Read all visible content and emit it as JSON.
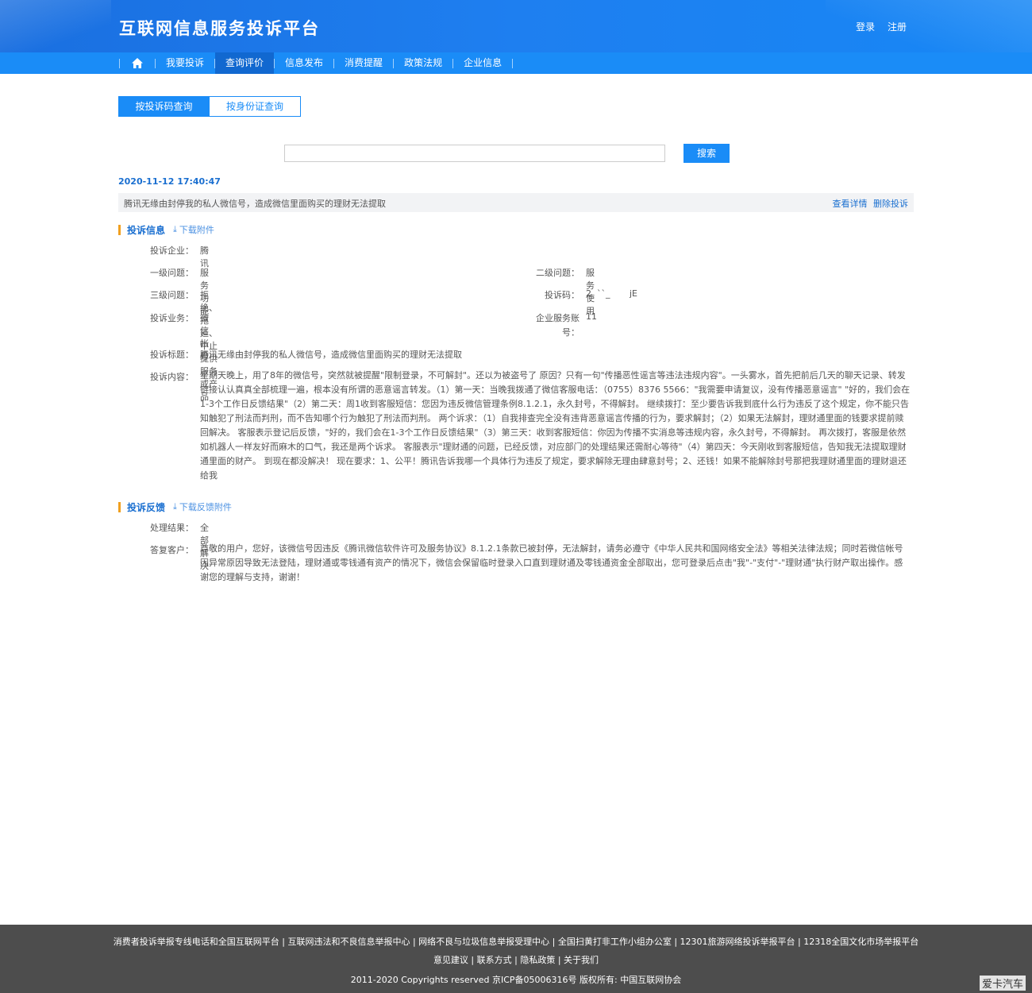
{
  "header": {
    "site_title": "互联网信息服务投诉平台",
    "login": "登录",
    "register": "注册"
  },
  "nav": {
    "home_icon": "home-icon",
    "items": [
      "我要投诉",
      "查询评价",
      "信息发布",
      "消费提醒",
      "政策法规",
      "企业信息"
    ],
    "active": "查询评价"
  },
  "query_tabs": {
    "by_code": "按投诉码查询",
    "by_id": "按身份证查询"
  },
  "search": {
    "value": "",
    "button": "搜索"
  },
  "record": {
    "datetime": "2020-11-12 17:40:47",
    "title": "腾讯无缘由封停我的私人微信号，造成微信里面购买的理财无法提取",
    "view_details": "查看详情",
    "delete": "删除投诉"
  },
  "complaint_info": {
    "heading": "投诉信息",
    "download": "下载附件",
    "company_label": "投诉企业：",
    "company": "腾讯",
    "level1_label": "一级问题：",
    "level1": "服务功能",
    "level2_label": "二级问题：",
    "level2": "服务使用",
    "level3_label": "三级问题：",
    "level3": "拒绝、拖延、中止提供服务或产品",
    "code_label": "投诉码：",
    "code": "2  ``_       jE",
    "business_label": "投诉业务：",
    "business": "微信帐号",
    "account_label_1": "企业服务账",
    "account_label_2": "号：",
    "account": "11",
    "subject_label": "投诉标题：",
    "subject": "腾讯无缘由封停我的私人微信号，造成微信里面购买的理财无法提取",
    "content_label": "投诉内容：",
    "content": "星期天晚上，用了8年的微信号，突然就被提醒\"限制登录，不可解封\"。还以为被盗号了 原因？只有一句\"传播恶性谣言等违法违规内容\"。一头雾水，首先把前后几天的聊天记录、转发链接认认真真全部梳理一遍，根本没有所谓的恶意谣言转发。（1）第一天：当晚我拨通了微信客服电话：（0755）8376 5566：\"我需要申请复议，没有传播恶意谣言\" \"好的，我们会在1-3个工作日反馈结果\"（2）第二天：周1收到客服短信：您因为违反微信管理条例8.1.2.1，永久封号，不得解封。 继续拨打：至少要告诉我到底什么行为违反了这个规定，你不能只告知触犯了刑法而判刑，而不告知哪个行为触犯了刑法而判刑。 两个诉求：（1）自我排查完全没有违背恶意谣言传播的行为，要求解封；（2）如果无法解封，理财通里面的钱要求提前赎回解决。 客服表示登记后反馈，\"好的，我们会在1-3个工作日反馈结果\"（3）第三天：收到客服短信：你因为传播不实消息等违规内容，永久封号，不得解封。 再次拨打，客服是依然如机器人一样友好而麻木的口气，我还是两个诉求。 客服表示\"理财通的问题，已经反馈，对应部门的处理结果还需耐心等待\"（4）第四天：今天刚收到客服短信，告知我无法提取理财通里面的财产。 到现在都没解决！ 现在要求：1、公平！腾讯告诉我哪一个具体行为违反了规定，要求解除无理由肆意封号；2、还钱！如果不能解除封号那把我理财通里面的理财退还给我"
  },
  "feedback": {
    "heading": "投诉反馈",
    "download": "下载反馈附件",
    "result_label": "处理结果：",
    "result": "全部解决",
    "reply_label": "答复客户：",
    "reply": "尊敬的用户，您好，该微信号因违反《腾讯微信软件许可及服务协议》8.1.2.1条款已被封停，无法解封，请务必遵守《中华人民共和国网络安全法》等相关法律法规；同时若微信帐号因异常原因导致无法登陆，理财通或零钱通有资产的情况下，微信会保留临时登录入口直到理财通及零钱通资金全部取出，您可登录后点击\"我\"-\"支付\"-\"理财通\"执行财产取出操作。感谢您的理解与支持，谢谢！"
  },
  "footer": {
    "line1": "消费者投诉举报专线电话和全国互联网平台 | 互联网违法和不良信息举报中心 | 网络不良与垃圾信息举报受理中心 | 全国扫黄打非工作小组办公室 | 12301旅游网络投诉举报平台 | 12318全国文化市场举报平台",
    "suggest": "意见建议",
    "contact": "联系方式",
    "privacy": "隐私政策",
    "about": "关于我们",
    "copyright": "2011-2020 Copyrights reserved 京ICP备05006316号 版权所有: 中国互联网协会"
  },
  "watermark": "爱卡汽车",
  "colors": {
    "primary": "#1a8cf7",
    "header": "#1e7ff0",
    "link": "#1a6fd0",
    "accent_bar": "#f0a020",
    "footer_bg": "#4d4d4d"
  }
}
